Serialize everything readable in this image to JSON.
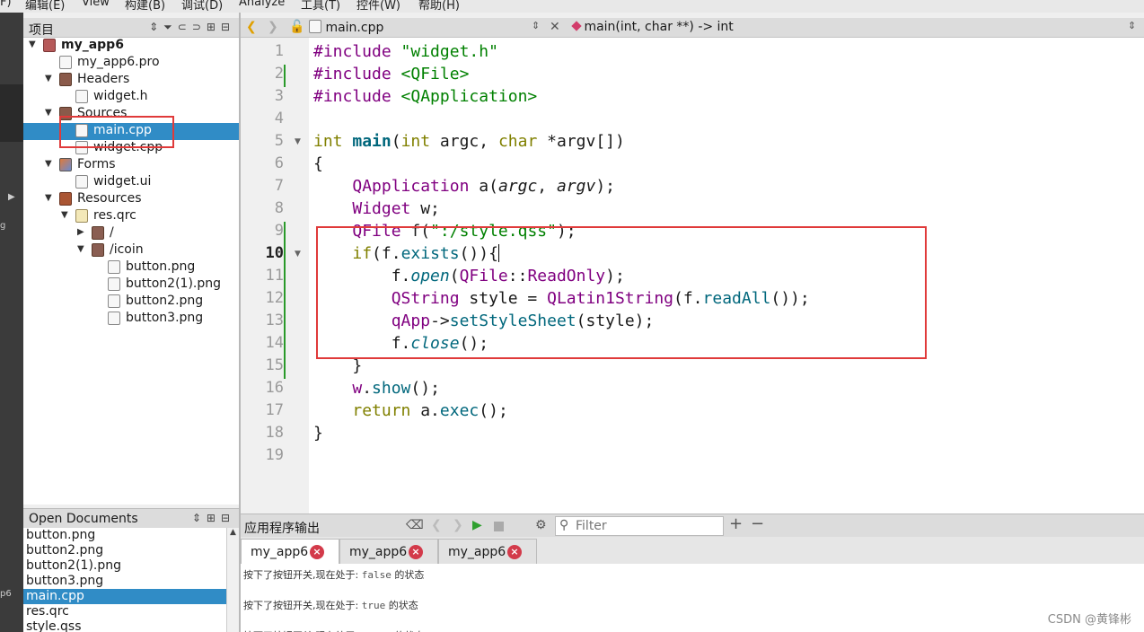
{
  "menu": [
    "F)",
    "编辑(E)",
    "View",
    "构建(B)",
    "调试(D)",
    "Analyze",
    "工具(T)",
    "控件(W)",
    "帮助(H)"
  ],
  "modebar": {
    "label_g": "g",
    "label_p6": "p6"
  },
  "project_panel": {
    "title": "项目",
    "tree": [
      {
        "label": "my_app6",
        "depth": 0,
        "arrow": "▼",
        "icon": "project-icon",
        "bold": true
      },
      {
        "label": "my_app6.pro",
        "depth": 1,
        "arrow": "",
        "icon": "pro-file-icon"
      },
      {
        "label": "Headers",
        "depth": 1,
        "arrow": "▼",
        "icon": "headers-folder-icon"
      },
      {
        "label": "widget.h",
        "depth": 2,
        "arrow": "",
        "icon": "header-file-icon"
      },
      {
        "label": "Sources",
        "depth": 1,
        "arrow": "▼",
        "icon": "sources-folder-icon"
      },
      {
        "label": "main.cpp",
        "depth": 2,
        "arrow": "",
        "icon": "cpp-file-icon",
        "selected": true
      },
      {
        "label": "widget.cpp",
        "depth": 2,
        "arrow": "",
        "icon": "cpp-file-icon"
      },
      {
        "label": "Forms",
        "depth": 1,
        "arrow": "▼",
        "icon": "forms-folder-icon"
      },
      {
        "label": "widget.ui",
        "depth": 2,
        "arrow": "",
        "icon": "ui-file-icon"
      },
      {
        "label": "Resources",
        "depth": 1,
        "arrow": "▼",
        "icon": "resources-folder-icon"
      },
      {
        "label": "res.qrc",
        "depth": 2,
        "arrow": "▼",
        "icon": "qrc-file-icon"
      },
      {
        "label": "/",
        "depth": 3,
        "arrow": "▶",
        "icon": "folder-icon"
      },
      {
        "label": "/icoin",
        "depth": 3,
        "arrow": "▼",
        "icon": "folder-icon"
      },
      {
        "label": "button.png",
        "depth": 4,
        "arrow": "",
        "icon": "image-file-icon"
      },
      {
        "label": "button2(1).png",
        "depth": 4,
        "arrow": "",
        "icon": "image-file-icon"
      },
      {
        "label": "button2.png",
        "depth": 4,
        "arrow": "",
        "icon": "image-file-icon"
      },
      {
        "label": "button3.png",
        "depth": 4,
        "arrow": "",
        "icon": "image-file-icon"
      }
    ]
  },
  "open_documents": {
    "title": "Open Documents",
    "items": [
      "button.png",
      "button2.png",
      "button2(1).png",
      "button3.png",
      "main.cpp",
      "res.qrc",
      "style.qss"
    ],
    "selected": "main.cpp"
  },
  "editor": {
    "file_name": "main.cpp",
    "symbol": "main(int, char **) -> int",
    "current_line": 10,
    "lines": [
      [
        {
          "t": "#include ",
          "c": "ty"
        },
        {
          "t": "\"widget.h\"",
          "c": "st"
        }
      ],
      [
        {
          "t": "#include ",
          "c": "ty"
        },
        {
          "t": "<QFile>",
          "c": "st"
        }
      ],
      [
        {
          "t": "#include ",
          "c": "ty"
        },
        {
          "t": "<QApplication>",
          "c": "st"
        }
      ],
      [],
      [
        {
          "t": "int ",
          "c": "kw"
        },
        {
          "t": "main",
          "c": "fb"
        },
        {
          "t": "(",
          "c": ""
        },
        {
          "t": "int ",
          "c": "kw"
        },
        {
          "t": "argc, ",
          "c": ""
        },
        {
          "t": "char ",
          "c": "kw"
        },
        {
          "t": "*argv[])",
          "c": ""
        }
      ],
      [
        {
          "t": "{",
          "c": ""
        }
      ],
      [
        {
          "t": "    ",
          "c": ""
        },
        {
          "t": "QApplication ",
          "c": "ty"
        },
        {
          "t": "a(",
          "c": ""
        },
        {
          "t": "argc",
          "c": "it"
        },
        {
          "t": ", ",
          "c": ""
        },
        {
          "t": "argv",
          "c": "it"
        },
        {
          "t": ");",
          "c": ""
        }
      ],
      [
        {
          "t": "    ",
          "c": ""
        },
        {
          "t": "Widget ",
          "c": "ty"
        },
        {
          "t": "w;",
          "c": ""
        }
      ],
      [
        {
          "t": "    ",
          "c": ""
        },
        {
          "t": "QFile ",
          "c": "ty"
        },
        {
          "t": "f(",
          "c": ""
        },
        {
          "t": "\":/style.qss\"",
          "c": "st"
        },
        {
          "t": ");",
          "c": ""
        }
      ],
      [
        {
          "t": "    ",
          "c": ""
        },
        {
          "t": "if",
          "c": "kw"
        },
        {
          "t": "(f.",
          "c": ""
        },
        {
          "t": "exists",
          "c": "fn"
        },
        {
          "t": "()){",
          "c": ""
        },
        {
          "t": "",
          "c": "caret"
        }
      ],
      [
        {
          "t": "        f.",
          "c": ""
        },
        {
          "t": "open",
          "c": "fn it"
        },
        {
          "t": "(",
          "c": ""
        },
        {
          "t": "QFile",
          "c": "ty"
        },
        {
          "t": "::",
          "c": ""
        },
        {
          "t": "ReadOnly",
          "c": "ty"
        },
        {
          "t": ");",
          "c": ""
        }
      ],
      [
        {
          "t": "        ",
          "c": ""
        },
        {
          "t": "QString ",
          "c": "ty"
        },
        {
          "t": "style = ",
          "c": ""
        },
        {
          "t": "QLatin1String",
          "c": "ty"
        },
        {
          "t": "(f.",
          "c": ""
        },
        {
          "t": "readAll",
          "c": "fn"
        },
        {
          "t": "());",
          "c": ""
        }
      ],
      [
        {
          "t": "        ",
          "c": ""
        },
        {
          "t": "qApp",
          "c": "ty"
        },
        {
          "t": "->",
          "c": ""
        },
        {
          "t": "setStyleSheet",
          "c": "fn"
        },
        {
          "t": "(style);",
          "c": ""
        }
      ],
      [
        {
          "t": "        f.",
          "c": ""
        },
        {
          "t": "close",
          "c": "fn it"
        },
        {
          "t": "();",
          "c": ""
        }
      ],
      [
        {
          "t": "    }",
          "c": ""
        }
      ],
      [
        {
          "t": "    ",
          "c": ""
        },
        {
          "t": "w",
          "c": "ty"
        },
        {
          "t": ".",
          "c": ""
        },
        {
          "t": "show",
          "c": "fn"
        },
        {
          "t": "();",
          "c": ""
        }
      ],
      [
        {
          "t": "    ",
          "c": ""
        },
        {
          "t": "return ",
          "c": "kw"
        },
        {
          "t": "a.",
          "c": ""
        },
        {
          "t": "exec",
          "c": "fn"
        },
        {
          "t": "();",
          "c": ""
        }
      ],
      [
        {
          "t": "}",
          "c": ""
        }
      ],
      []
    ]
  },
  "output": {
    "title": "应用程序输出",
    "filter_placeholder": "Filter",
    "tabs": [
      "my_app6",
      "my_app6",
      "my_app6"
    ],
    "lines": [
      {
        "prefix": "按下了按钮开关,现在处于: ",
        "value": "false",
        "suffix": " 的状态"
      },
      {
        "prefix": "按下了按钮开关,现在处于: ",
        "value": "true",
        "suffix": " 的状态"
      },
      {
        "prefix": "按下了按钮开关,现在处于: ",
        "value": "false",
        "suffix": " 的状态"
      }
    ]
  },
  "watermark": "CSDN @黄锋彬",
  "colors": {
    "selection": "#308cc6",
    "annotation_red": "#e03a3a",
    "keyword": "#808000",
    "type": "#800080",
    "string": "#008000",
    "function": "#00677c"
  }
}
